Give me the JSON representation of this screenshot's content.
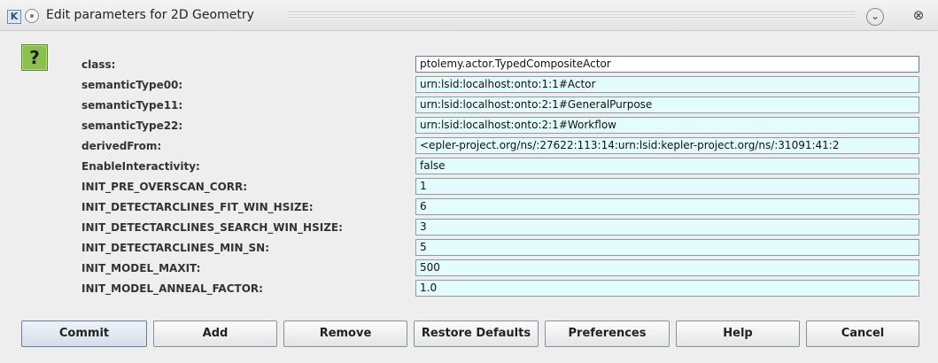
{
  "window": {
    "app_icon": "K",
    "title": "Edit parameters for 2D Geometry",
    "icons": {
      "menu": "window-menu-icon",
      "minimize": "minimize-icon",
      "close": "close-icon"
    }
  },
  "help_badge": "?",
  "parameters": [
    {
      "label": "class:",
      "value": "ptolemy.actor.TypedCompositeActor"
    },
    {
      "label": "semanticType00:",
      "value": "urn:lsid:localhost:onto:1:1#Actor"
    },
    {
      "label": "semanticType11:",
      "value": "urn:lsid:localhost:onto:2:1#GeneralPurpose"
    },
    {
      "label": "semanticType22:",
      "value": "urn:lsid:localhost:onto:2:1#Workflow"
    },
    {
      "label": "derivedFrom:",
      "value": "<epler-project.org/ns/:27622:113:14:urn:lsid:kepler-project.org/ns/:31091:41:2"
    },
    {
      "label": "EnableInteractivity:",
      "value": "false"
    },
    {
      "label": "INIT_PRE_OVERSCAN_CORR:",
      "value": "1"
    },
    {
      "label": "INIT_DETECTARCLINES_FIT_WIN_HSIZE:",
      "value": "6"
    },
    {
      "label": "INIT_DETECTARCLINES_SEARCH_WIN_HSIZE:",
      "value": "3"
    },
    {
      "label": "INIT_DETECTARCLINES_MIN_SN:",
      "value": "5"
    },
    {
      "label": "INIT_MODEL_MAXIT:",
      "value": "500"
    },
    {
      "label": "INIT_MODEL_ANNEAL_FACTOR:",
      "value": "1.0"
    }
  ],
  "buttons": [
    "Commit",
    "Add",
    "Remove",
    "Restore Defaults",
    "Preferences",
    "Help",
    "Cancel"
  ],
  "colors": {
    "field_background": "#e3fdfd",
    "help_badge": "#8cc04d"
  }
}
